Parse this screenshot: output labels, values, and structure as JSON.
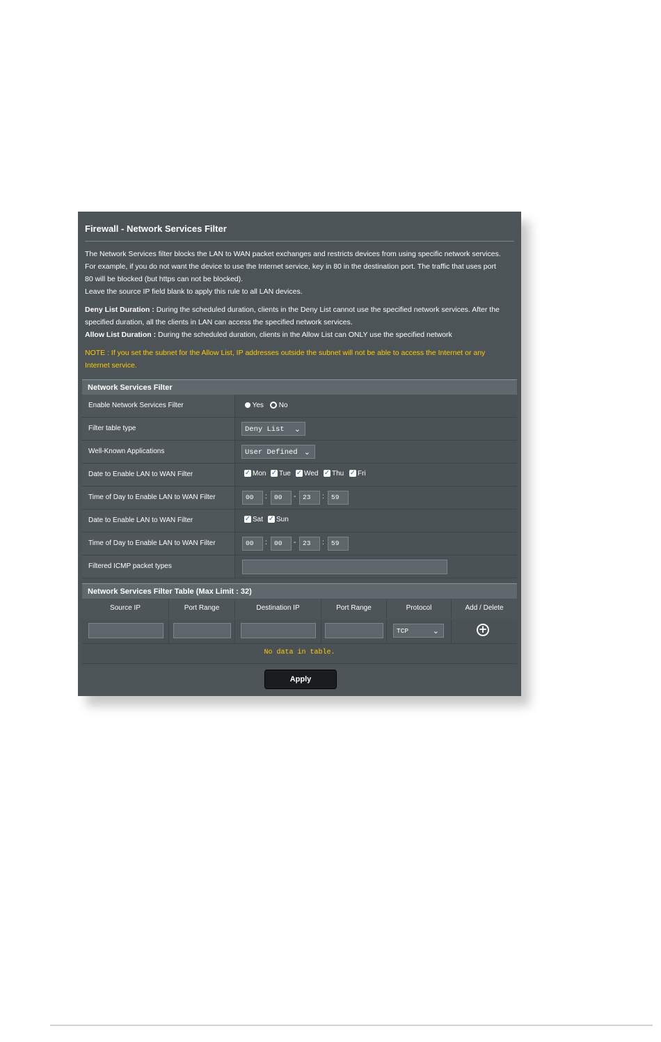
{
  "page": {
    "title": "Firewall - Network Services Filter",
    "desc1": "The Network Services filter blocks the LAN to WAN packet exchanges and restricts devices from using specific network services.",
    "desc2": "For example, if you do not want the device to use the Internet service, key in 80 in the destination port. The traffic that uses port",
    "desc3": "80 will be blocked (but https can not be blocked).",
    "desc4": "Leave the source IP field blank to apply this rule to all LAN devices.",
    "deny_label": "Deny List Duration :",
    "deny_text1": "During the scheduled duration, clients in the Deny List cannot use the specified network services. After the",
    "deny_text2": "specified duration, all the clients in LAN can access the specified network services.",
    "allow_label": "Allow List Duration :",
    "allow_text": "During the scheduled duration, clients in the Allow List can ONLY use the specified network",
    "note1": "NOTE : If you set the subnet for the Allow List, IP addresses outside the subnet will not be able to access the Internet or any",
    "note2": "Internet service."
  },
  "settings": {
    "section_title": "Network Services Filter",
    "enable_label": "Enable Network Services Filter",
    "yes": "Yes",
    "no": "No",
    "filter_type_label": "Filter table type",
    "filter_type_value": "Deny List",
    "wellknown_label": "Well-Known Applications",
    "wellknown_value": "User Defined",
    "date1_label": "Date to Enable LAN to WAN Filter",
    "weekdays": [
      "Mon",
      "Tue",
      "Wed",
      "Thu",
      "Fri"
    ],
    "time1_label": "Time of Day to Enable LAN to WAN Filter",
    "time1": [
      "00",
      "00",
      "23",
      "59"
    ],
    "date2_label": "Date to Enable LAN to WAN Filter",
    "weekend": [
      "Sat",
      "Sun"
    ],
    "time2_label": "Time of Day to Enable LAN to WAN Filter",
    "time2": [
      "00",
      "00",
      "23",
      "59"
    ],
    "icmp_label": "Filtered ICMP packet types"
  },
  "table": {
    "section_title": "Network Services Filter Table (Max Limit : 32)",
    "headers": [
      "Source IP",
      "Port Range",
      "Destination IP",
      "Port Range",
      "Protocol",
      "Add / Delete"
    ],
    "protocol_value": "TCP",
    "empty_text": "No data in table."
  },
  "apply_label": "Apply",
  "colors": {
    "panel": "#4d5457",
    "note": "#ffcc00",
    "button": "#1a1d1f"
  }
}
